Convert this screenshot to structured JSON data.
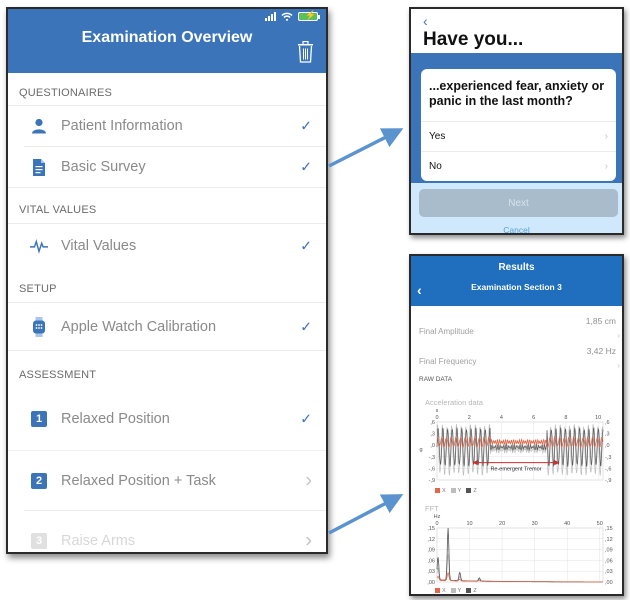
{
  "left_screen": {
    "title": "Examination Overview",
    "status_bar": {
      "signal_icon": "signal-icon",
      "wifi_icon": "wifi-icon",
      "battery_icon": "battery-charging-icon"
    },
    "delete_icon": "trash-icon",
    "accent_color": "#3b74b9",
    "sections": [
      {
        "header": "QUESTIONAIRES",
        "items": [
          {
            "label": "Patient Information",
            "icon": "person-icon",
            "status": "completed",
            "trail_icon": "checkmark-icon",
            "trail": "✓"
          },
          {
            "label": "Basic Survey",
            "icon": "document-icon",
            "status": "completed",
            "trail_icon": "checkmark-icon",
            "trail": "✓"
          }
        ]
      },
      {
        "header": "VITAL VALUES",
        "items": [
          {
            "label": "Vital Values",
            "icon": "heartbeat-icon",
            "status": "completed",
            "trail_icon": "checkmark-icon",
            "trail": "✓"
          }
        ]
      },
      {
        "header": "SETUP",
        "items": [
          {
            "label": "Apple Watch Calibration",
            "icon": "watch-icon",
            "status": "completed",
            "trail_icon": "checkmark-icon",
            "trail": "✓"
          }
        ]
      },
      {
        "header": "ASSESSMENT",
        "items": [
          {
            "label": "Relaxed Position",
            "badge": "1",
            "status": "completed",
            "trail_icon": "checkmark-icon",
            "trail": "✓"
          },
          {
            "label": "Relaxed Position + Task",
            "badge": "2",
            "status": "pending",
            "trail_icon": "chevron-right-icon",
            "trail": "›"
          },
          {
            "label": "Raise Arms",
            "badge": "3",
            "status": "disabled",
            "trail_icon": "chevron-right-icon",
            "trail": "›"
          }
        ]
      }
    ]
  },
  "question_screen": {
    "back": "‹",
    "title": "Have you...",
    "question": "...experienced fear, anxiety or panic in the last month?",
    "options": [
      {
        "label": "Yes",
        "chevron": "›"
      },
      {
        "label": "No",
        "chevron": "›"
      }
    ],
    "next_label": "Next",
    "cancel_label": "Cancel"
  },
  "results_screen": {
    "title": "Results",
    "subtitle": "Examination Section 3",
    "back": "‹",
    "metrics": [
      {
        "label": "Final Amplitude",
        "value": "1,85 cm"
      },
      {
        "label": "Final Frequency",
        "value": "3,42 Hz"
      }
    ],
    "raw_data_header": "RAW DATA",
    "chevron": "›"
  },
  "chart_data": [
    {
      "type": "line",
      "title": "Acceleration data",
      "xlabel": "s",
      "ylabel": "g",
      "x_ticks": [
        "0",
        "2",
        "4",
        "6",
        "8",
        "10"
      ],
      "y_ticks": [
        ",6",
        ",3",
        ",0",
        "-,3",
        "-,6",
        "-,9"
      ],
      "xlim": [
        0,
        10.3
      ],
      "ylim": [
        -0.9,
        0.6
      ],
      "grid": true,
      "legend": [
        "X",
        "Y",
        "Z"
      ],
      "legend_position": "bottom-left",
      "series_colors": {
        "X": "#e0674a",
        "Y": "#bdbdbd",
        "Z": "#555555"
      },
      "annotation": {
        "text": "Re-emergent Tremor",
        "x_range": [
          2.2,
          7.6
        ],
        "y": -0.45,
        "color": "#d42a2a"
      },
      "segments": [
        {
          "x_range": [
            0,
            3.3
          ],
          "behavior": "tremor",
          "amplitude_g": 0.6,
          "frequency_hz": 3.42
        },
        {
          "x_range": [
            3.3,
            6.8
          ],
          "behavior": "rest",
          "amplitude_g": 0.05
        },
        {
          "x_range": [
            6.8,
            10.3
          ],
          "behavior": "tremor",
          "amplitude_g": 0.6,
          "frequency_hz": 3.42
        }
      ]
    },
    {
      "type": "line",
      "title": "FFT",
      "xlabel": "Hz",
      "x_ticks": [
        "0",
        "10",
        "20",
        "30",
        "40",
        "50"
      ],
      "y_ticks": [
        ",15",
        ",12",
        ",09",
        ",06",
        ",03",
        ",00"
      ],
      "xlim": [
        0,
        51
      ],
      "ylim": [
        0,
        0.16
      ],
      "grid": true,
      "legend": [
        "X",
        "Y",
        "Z"
      ],
      "legend_position": "bottom-left",
      "series_colors": {
        "X": "#e0674a",
        "Y": "#bdbdbd",
        "Z": "#555555"
      },
      "peaks": [
        {
          "x": 0.3,
          "y": 0.07
        },
        {
          "x": 3.4,
          "y": 0.155
        },
        {
          "x": 7,
          "y": 0.025
        },
        {
          "x": 13,
          "y": 0.01
        }
      ]
    }
  ]
}
